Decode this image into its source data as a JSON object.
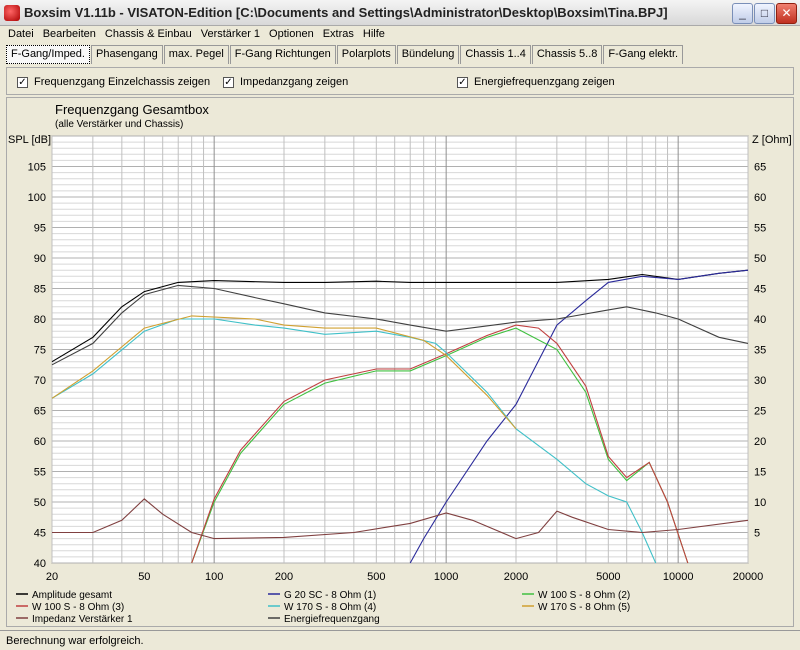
{
  "window": {
    "title": "Boxsim V1.11b - VISATON-Edition [C:\\Documents and Settings\\Administrator\\Desktop\\Boxsim\\Tina.BPJ]",
    "min": "_",
    "max": "□",
    "close": "✕"
  },
  "menu": [
    "Datei",
    "Bearbeiten",
    "Chassis & Einbau",
    "Verstärker 1",
    "Optionen",
    "Extras",
    "Hilfe"
  ],
  "tabs": [
    "F-Gang/Imped.",
    "Phasengang",
    "max. Pegel",
    "F-Gang Richtungen",
    "Polarplots",
    "Bündelung",
    "Chassis 1..4",
    "Chassis 5..8",
    "F-Gang elektr."
  ],
  "checkboxes": [
    {
      "label": "Frequenzgang Einzelchassis zeigen",
      "checked": true
    },
    {
      "label": "Impedanzgang zeigen",
      "checked": true
    },
    {
      "label": "Energiefrequenzgang zeigen",
      "checked": true
    }
  ],
  "status": "Berechnung war erfolgreich.",
  "chart_data": {
    "type": "line",
    "title": "Frequenzgang Gesamtbox",
    "subtitle": "(alle Verstärker und Chassis)",
    "ylabel": "SPL [dB]",
    "y2label": "Z [Ohm]",
    "ylim": [
      40,
      110
    ],
    "y2lim": [
      0,
      70
    ],
    "xlim": [
      20,
      20000
    ],
    "xscale": "log",
    "xticks": [
      20,
      50,
      100,
      200,
      500,
      1000,
      2000,
      5000,
      10000,
      20000
    ],
    "yticks": [
      40,
      45,
      50,
      55,
      60,
      65,
      70,
      75,
      80,
      85,
      90,
      95,
      100,
      105
    ],
    "y2ticks": [
      5,
      10,
      15,
      20,
      25,
      30,
      35,
      40,
      45,
      50,
      55,
      60,
      65
    ],
    "series": [
      {
        "name": "Amplitude gesamt",
        "color": "#000000",
        "axis": "spl",
        "points": [
          [
            20,
            73
          ],
          [
            30,
            77
          ],
          [
            40,
            82
          ],
          [
            50,
            84.5
          ],
          [
            70,
            86
          ],
          [
            100,
            86.3
          ],
          [
            200,
            86
          ],
          [
            300,
            86
          ],
          [
            500,
            86.2
          ],
          [
            700,
            86
          ],
          [
            1000,
            86
          ],
          [
            2000,
            86
          ],
          [
            3000,
            86
          ],
          [
            5000,
            86.5
          ],
          [
            7000,
            87.3
          ],
          [
            10000,
            86.5
          ],
          [
            15000,
            87.5
          ],
          [
            20000,
            88
          ]
        ]
      },
      {
        "name": "G 20 SC - 8 Ohm (1)",
        "color": "#2a2a9a",
        "axis": "spl",
        "points": [
          [
            700,
            40
          ],
          [
            800,
            44
          ],
          [
            1000,
            50
          ],
          [
            1500,
            60
          ],
          [
            2000,
            66
          ],
          [
            3000,
            79
          ],
          [
            4000,
            83
          ],
          [
            5000,
            86
          ],
          [
            7000,
            87
          ],
          [
            10000,
            86.5
          ],
          [
            15000,
            87.5
          ],
          [
            20000,
            88
          ]
        ]
      },
      {
        "name": "W 100 S - 8 Ohm (2)",
        "color": "#40c040",
        "axis": "spl",
        "points": [
          [
            80,
            40
          ],
          [
            100,
            50
          ],
          [
            130,
            58
          ],
          [
            200,
            66
          ],
          [
            300,
            69.5
          ],
          [
            500,
            71.5
          ],
          [
            700,
            71.5
          ],
          [
            1000,
            74
          ],
          [
            1500,
            77
          ],
          [
            2000,
            78.5
          ],
          [
            3000,
            75
          ],
          [
            4000,
            68
          ],
          [
            5000,
            57
          ],
          [
            6000,
            53.5
          ],
          [
            7500,
            56.5
          ],
          [
            9000,
            50
          ],
          [
            11000,
            40
          ]
        ]
      },
      {
        "name": "W 100 S - 8 Ohm (3)",
        "color": "#c04040",
        "axis": "spl",
        "points": [
          [
            80,
            40
          ],
          [
            100,
            50.5
          ],
          [
            130,
            58.5
          ],
          [
            200,
            66.5
          ],
          [
            300,
            70
          ],
          [
            500,
            71.8
          ],
          [
            700,
            71.8
          ],
          [
            1000,
            74.3
          ],
          [
            1500,
            77.3
          ],
          [
            2000,
            79
          ],
          [
            2500,
            78.5
          ],
          [
            3000,
            76
          ],
          [
            4000,
            69
          ],
          [
            5000,
            57.5
          ],
          [
            6000,
            54
          ],
          [
            7500,
            56.5
          ],
          [
            9000,
            50
          ],
          [
            11000,
            40
          ]
        ]
      },
      {
        "name": "W 170 S - 8 Ohm (4)",
        "color": "#40c0c8",
        "axis": "spl",
        "points": [
          [
            20,
            67
          ],
          [
            30,
            71
          ],
          [
            50,
            78
          ],
          [
            70,
            80
          ],
          [
            100,
            80
          ],
          [
            150,
            79
          ],
          [
            200,
            78.5
          ],
          [
            300,
            77.5
          ],
          [
            500,
            78
          ],
          [
            700,
            77
          ],
          [
            900,
            76
          ],
          [
            1000,
            74.5
          ],
          [
            1500,
            68
          ],
          [
            2000,
            62
          ],
          [
            3000,
            57
          ],
          [
            4000,
            53
          ],
          [
            5000,
            51
          ],
          [
            6000,
            50
          ],
          [
            7000,
            45
          ],
          [
            8000,
            40
          ]
        ]
      },
      {
        "name": "W 170 S - 8 Ohm (5)",
        "color": "#d0a030",
        "axis": "spl",
        "points": [
          [
            20,
            67
          ],
          [
            30,
            71.5
          ],
          [
            50,
            78.5
          ],
          [
            80,
            80.5
          ],
          [
            150,
            80
          ],
          [
            200,
            79
          ],
          [
            300,
            78.5
          ],
          [
            500,
            78.5
          ],
          [
            800,
            76.5
          ],
          [
            1000,
            74
          ],
          [
            1500,
            67.5
          ],
          [
            2000,
            62
          ]
        ]
      },
      {
        "name": "Impedanz Verstärker 1",
        "color": "#804040",
        "axis": "z",
        "points": [
          [
            20,
            5
          ],
          [
            30,
            5
          ],
          [
            40,
            7
          ],
          [
            50,
            10.5
          ],
          [
            60,
            8
          ],
          [
            80,
            5
          ],
          [
            100,
            4
          ],
          [
            200,
            4.2
          ],
          [
            400,
            5
          ],
          [
            700,
            6.5
          ],
          [
            1000,
            8.2
          ],
          [
            1300,
            7
          ],
          [
            2000,
            4
          ],
          [
            2500,
            5
          ],
          [
            3000,
            8.5
          ],
          [
            3500,
            7.5
          ],
          [
            5000,
            5.5
          ],
          [
            7000,
            5
          ],
          [
            10000,
            5.5
          ],
          [
            20000,
            7
          ]
        ]
      },
      {
        "name": "Energiefrequenzgang",
        "color": "#404040",
        "axis": "spl",
        "points": [
          [
            20,
            72.5
          ],
          [
            30,
            76
          ],
          [
            40,
            81
          ],
          [
            50,
            84
          ],
          [
            70,
            85.5
          ],
          [
            100,
            85
          ],
          [
            150,
            83.5
          ],
          [
            200,
            82.5
          ],
          [
            300,
            81
          ],
          [
            500,
            80
          ],
          [
            700,
            79
          ],
          [
            1000,
            78
          ],
          [
            2000,
            79.5
          ],
          [
            3000,
            80
          ],
          [
            5000,
            81.5
          ],
          [
            6000,
            82
          ],
          [
            8000,
            81
          ],
          [
            10000,
            80
          ],
          [
            15000,
            77
          ],
          [
            20000,
            76
          ]
        ]
      }
    ]
  }
}
